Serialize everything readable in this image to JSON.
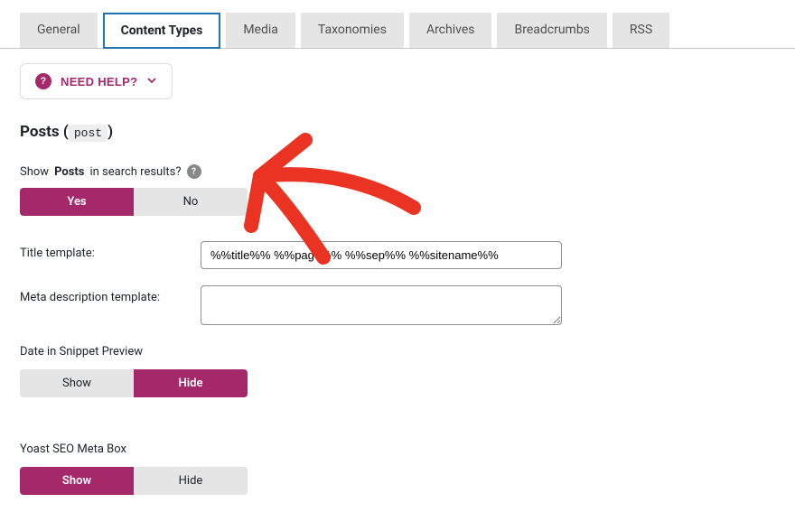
{
  "tabs": {
    "general": "General",
    "content_types": "Content Types",
    "media": "Media",
    "taxonomies": "Taxonomies",
    "archives": "Archives",
    "breadcrumbs": "Breadcrumbs",
    "rss": "RSS"
  },
  "help": {
    "label": "NEED HELP?"
  },
  "section": {
    "title_prefix": "Posts (",
    "title_code": "post",
    "title_suffix": ")"
  },
  "show_posts": {
    "prefix": "Show ",
    "strong": "Posts",
    "suffix": " in search results?",
    "yes": "Yes",
    "no": "No",
    "selected": "yes"
  },
  "title_template": {
    "label": "Title template:",
    "value": "%%title%% %%page%% %%sep%% %%sitename%%"
  },
  "meta_desc": {
    "label": "Meta description template:",
    "value": ""
  },
  "date_snippet": {
    "label": "Date in Snippet Preview",
    "show": "Show",
    "hide": "Hide",
    "selected": "hide"
  },
  "meta_box": {
    "label": "Yoast SEO Meta Box",
    "show": "Show",
    "hide": "Hide",
    "selected": "show"
  },
  "colors": {
    "accent": "#a4286a",
    "arrow": "#ea3323"
  }
}
